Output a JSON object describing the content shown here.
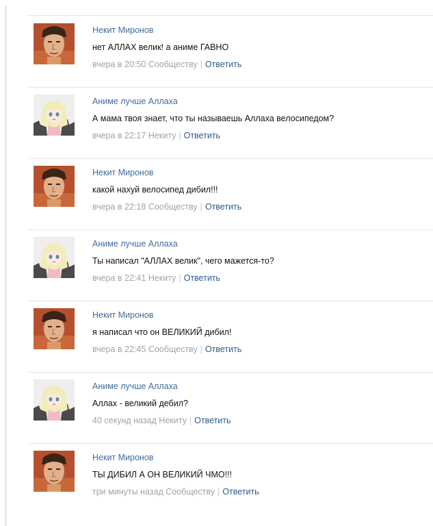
{
  "comments": [
    {
      "author": "Некит Миронов",
      "avatar": "man-avatar-icon",
      "text": "нет АЛЛАХ велик! а аниме ГАВНО",
      "time": "вчера в 20:50",
      "to": "Сообществу",
      "separator": "|",
      "reply": "Ответить"
    },
    {
      "author": "Аниме лучше Аллаха",
      "avatar": "anime-girl-avatar-icon",
      "text": "А мама твоя знает, что ты называешь Аллаха велосипедом?",
      "time": "вчера в 22:17",
      "to": "Некиту",
      "separator": "|",
      "reply": "Ответить"
    },
    {
      "author": "Некит Миронов",
      "avatar": "man-avatar-icon",
      "text": "какой нахуй велосипед дибил!!!",
      "time": "вчера в 22:18",
      "to": "Сообществу",
      "separator": "|",
      "reply": "Ответить"
    },
    {
      "author": "Аниме лучше Аллаха",
      "avatar": "anime-girl-avatar-icon",
      "text": "Ты написал \"АЛЛАХ велик\", чего мажется-то?",
      "time": "вчера в 22:41",
      "to": "Некиту",
      "separator": "|",
      "reply": "Ответить"
    },
    {
      "author": "Некит Миронов",
      "avatar": "man-avatar-icon",
      "text": "я написал что он ВЕЛИКИЙ дибил!",
      "time": "вчера в 22:45",
      "to": "Сообществу",
      "separator": "|",
      "reply": "Ответить"
    },
    {
      "author": "Аниме лучше Аллаха",
      "avatar": "anime-girl-avatar-icon",
      "text": "Аллах - великий дебил?",
      "time": "40 секунд назад",
      "to": "Некиту",
      "separator": "|",
      "reply": "Ответить"
    },
    {
      "author": "Некит Миронов",
      "avatar": "man-avatar-icon",
      "text": "ТЫ ДИБИЛ А ОН ВЕЛИКИЙ ЧМО!!!",
      "time": "три минуты назад",
      "to": "Сообществу",
      "separator": "|",
      "reply": "Ответить"
    }
  ],
  "colors": {
    "author": "#3f6c9b",
    "reply": "#2b5c8d",
    "meta": "#9aa4ad",
    "text": "#111111"
  }
}
